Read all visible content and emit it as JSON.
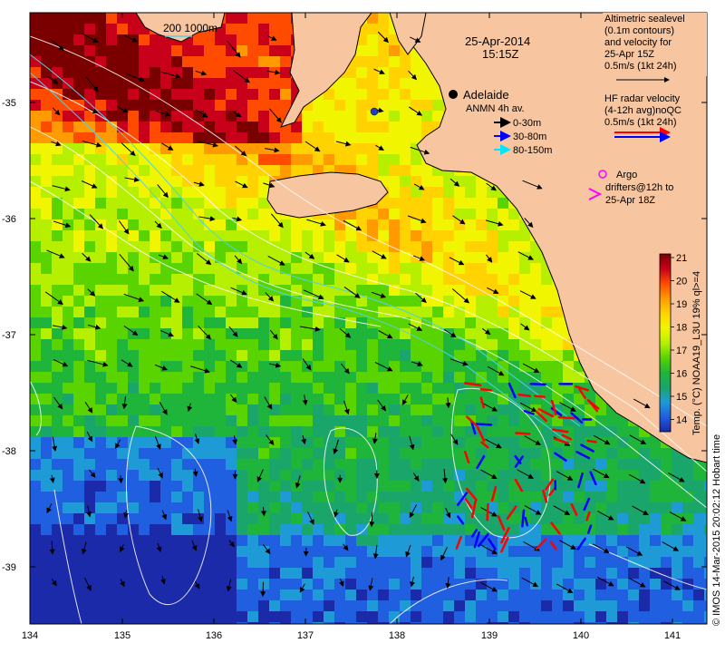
{
  "map": {
    "date": "25-Apr-2014",
    "time": "15:15Z",
    "place": "Adelaide",
    "isobaths": "200  1000m",
    "colors": {
      "land": "#f7c59f",
      "coast": "#000000",
      "contour": "#ffffff",
      "isobath": "#4fd3e6"
    },
    "lon_ticks": [
      "134",
      "135",
      "136",
      "137",
      "138",
      "139",
      "140",
      "141"
    ],
    "lat_ticks": [
      "-35",
      "-36",
      "-37",
      "-38",
      "-39"
    ]
  },
  "legend": {
    "alt_title": [
      "Altimetric sealevel",
      "(0.1m contours)",
      "and velocity for",
      "25-Apr 15Z",
      "0.5m/s (1kt 24h)"
    ],
    "hf_title": [
      "HF radar velocity",
      "(4-12h avg)noQC",
      "0.5m/s (1kt 24h)"
    ],
    "anmn_title": "ANMN 4h av.",
    "anmn_items": [
      {
        "label": "0-30m",
        "color": "#000000"
      },
      {
        "label": "30-80m",
        "color": "#0000ff"
      },
      {
        "label": "80-150m",
        "color": "#00e5ff"
      }
    ],
    "argo": [
      "Argo",
      "drifters@12h to",
      "25-Apr 18Z"
    ],
    "argo_color": "#ff00ff",
    "hf_colors": [
      "#ff0000",
      "#0000ff"
    ]
  },
  "colorbar": {
    "ticks": [
      "21",
      "20",
      "19",
      "18",
      "17",
      "16",
      "15",
      "14"
    ],
    "label": "Temp. (°C) NOAA19_L3U 19% ql>=4",
    "stops": [
      "#7a0000",
      "#c8001a",
      "#ff4b00",
      "#ff9a00",
      "#ffd200",
      "#f2f500",
      "#b6f000",
      "#5ad400",
      "#1fb53a",
      "#1aa56a",
      "#1e9bd7",
      "#1f5fe0",
      "#1a2aa8"
    ]
  },
  "credit": "© IMOS 14-Mar-2015 20:02:12 Hobart time"
}
